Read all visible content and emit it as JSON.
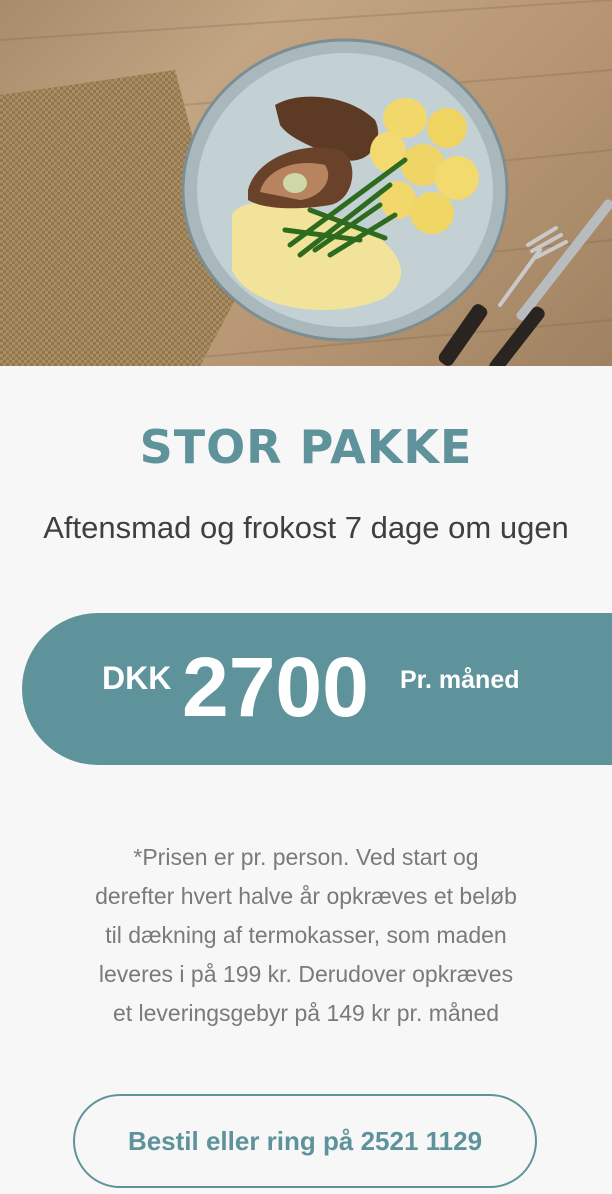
{
  "hero": {
    "image_alt": "Plate with meatloaf, potatoes, green beans and sauce"
  },
  "package": {
    "title": "STOR PAKKE",
    "subtitle": "Aftensmad og frokost 7 dage om ugen"
  },
  "price": {
    "currency": "DKK",
    "amount": "2700",
    "period": "Pr. måned"
  },
  "note": {
    "lines": [
      "*Prisen er pr. person. Ved start og",
      "derefter hvert halve år opkræves et beløb",
      "til dækning af termokasser, som maden",
      "leveres i på 199 kr. Derudover opkræves",
      "et leveringsgebyr på 149 kr pr. måned"
    ]
  },
  "cta": {
    "label": "Bestil eller ring på 2521 1129"
  },
  "colors": {
    "accent": "#5f939c",
    "background": "#f7f7f7",
    "text_dark": "#3f3f3f",
    "text_muted": "#7a7a7a"
  }
}
